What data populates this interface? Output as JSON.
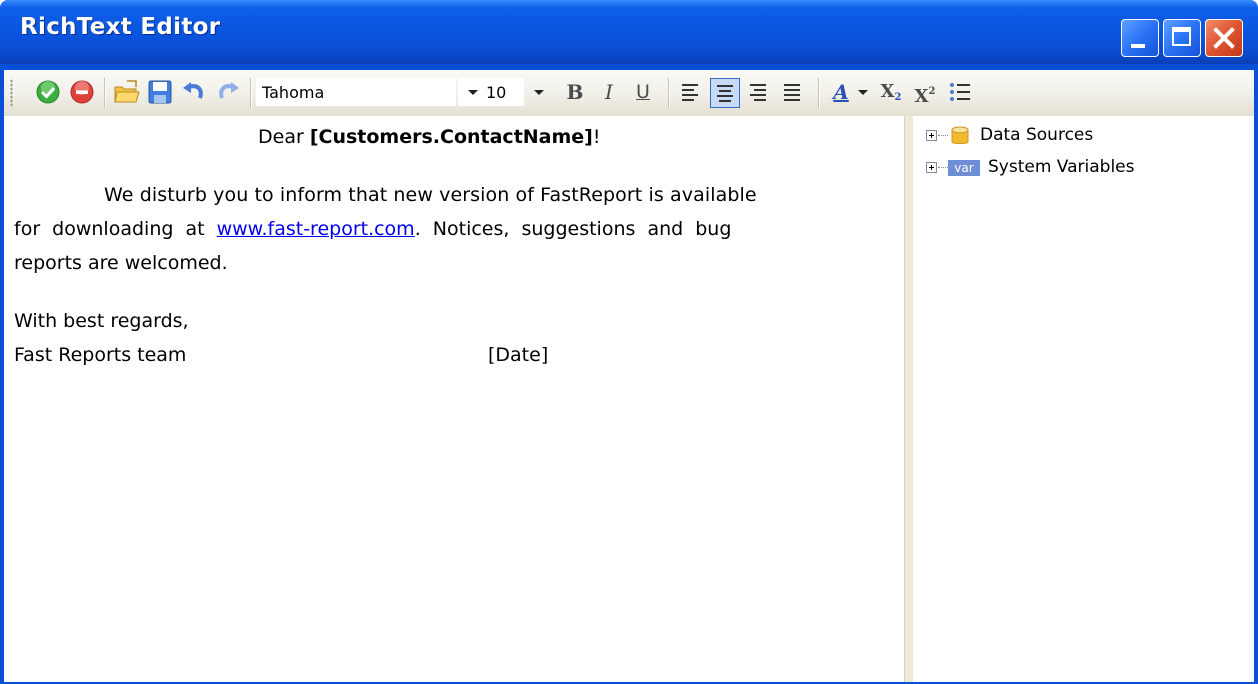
{
  "window": {
    "title": "RichText Editor"
  },
  "toolbar": {
    "font_name": "Tahoma",
    "font_size": "10",
    "bold_label": "B",
    "italic_label": "I",
    "underline_label": "U",
    "subscript_label": "X",
    "subscript_sub": "2",
    "superscript_label": "X",
    "superscript_sup": "2",
    "font_color_label": "A",
    "active_alignment": "center"
  },
  "document": {
    "greeting_prefix": "Dear ",
    "greeting_field": "[Customers.ContactName]",
    "greeting_suffix": "!",
    "para1_line1": "We disturb you to inform that new version of FastReport is available",
    "para1_line2_prefix": "for downloading at ",
    "para1_link": "www.fast-report.com",
    "para1_line2_suffix": ". Notices, suggestions and bug",
    "para1_line3": "reports are welcomed.",
    "closing": "With best regards,",
    "signature": "Fast Reports team",
    "date_field": "[Date]"
  },
  "tree": {
    "items": [
      {
        "label": "Data Sources",
        "icon": "database-icon"
      },
      {
        "label": "System Variables",
        "icon": "var-icon",
        "icon_text": "var"
      }
    ]
  },
  "colors": {
    "titlebar": "#0a54dd",
    "link": "#0000ee",
    "active_button": "#c8daf5"
  }
}
